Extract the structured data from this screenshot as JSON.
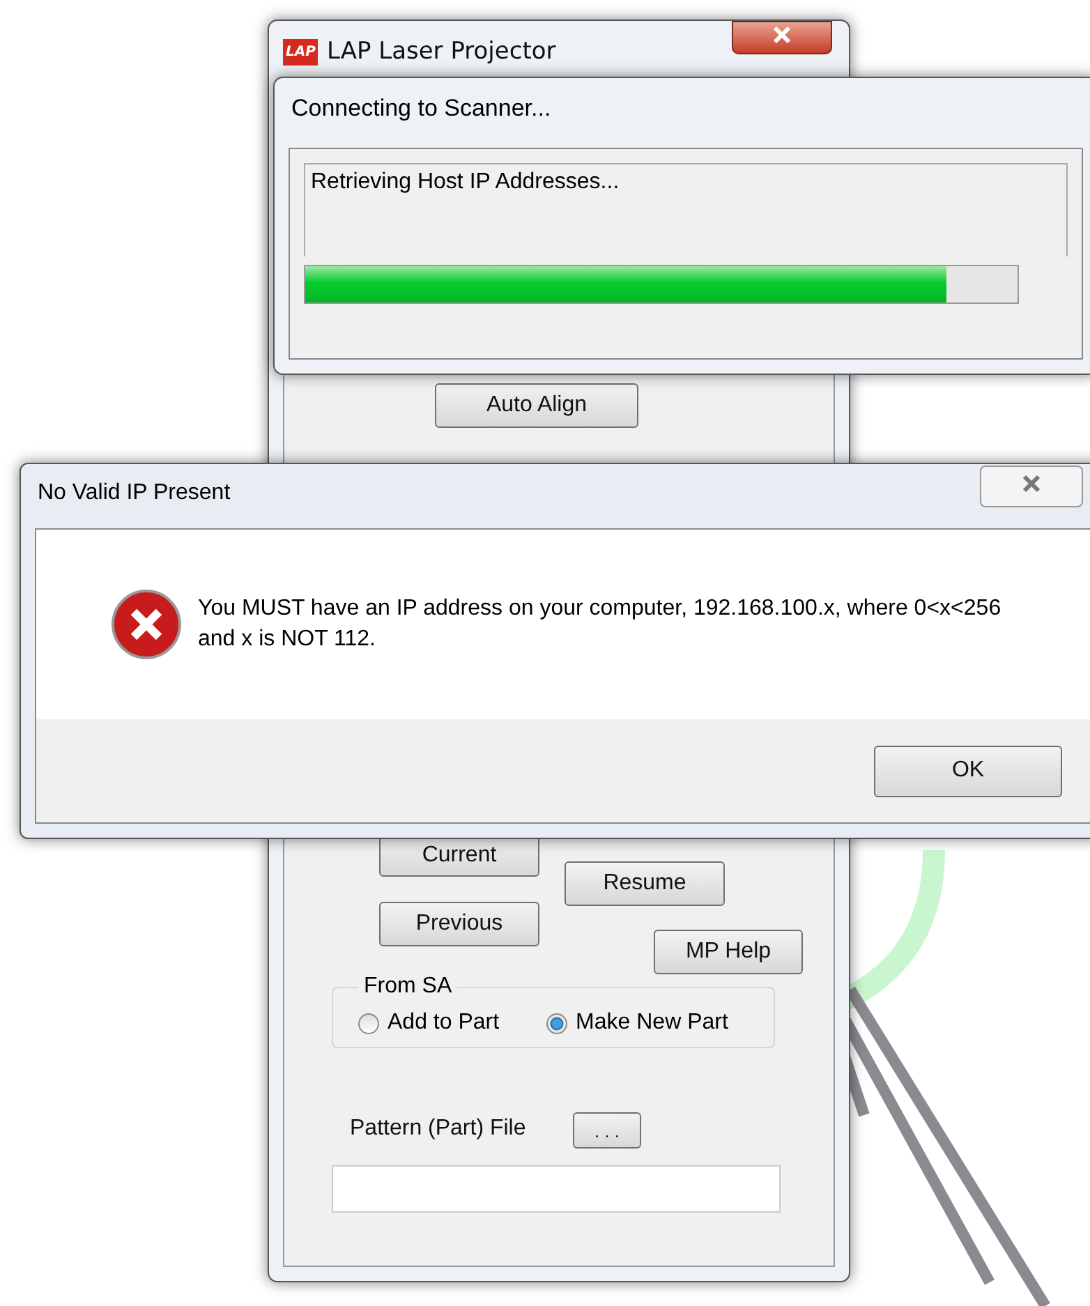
{
  "main_window": {
    "logo": "LAP",
    "title": "LAP Laser Projector",
    "buttons": [
      {
        "label": "Auto Align"
      },
      {
        "label": "Current"
      },
      {
        "label": "Resume"
      },
      {
        "label": "Previous"
      },
      {
        "label": "MP Help"
      }
    ],
    "group": {
      "title": "From SA",
      "options": [
        {
          "label": "Add to Part",
          "selected": false
        },
        {
          "label": "Make New Part",
          "selected": true
        }
      ]
    },
    "file": {
      "label": "Pattern (Part) File",
      "browse": ". . ."
    }
  },
  "progress_dialog": {
    "title": "Connecting to Scanner...",
    "status": "Retrieving Host IP Addresses...",
    "level": 0.9
  },
  "error_dialog": {
    "title": "No Valid IP Present",
    "message": "You MUST have an IP address on your computer, 192.168.100.x, where 0<x<256 and x is NOT 112.",
    "button": "OK"
  }
}
